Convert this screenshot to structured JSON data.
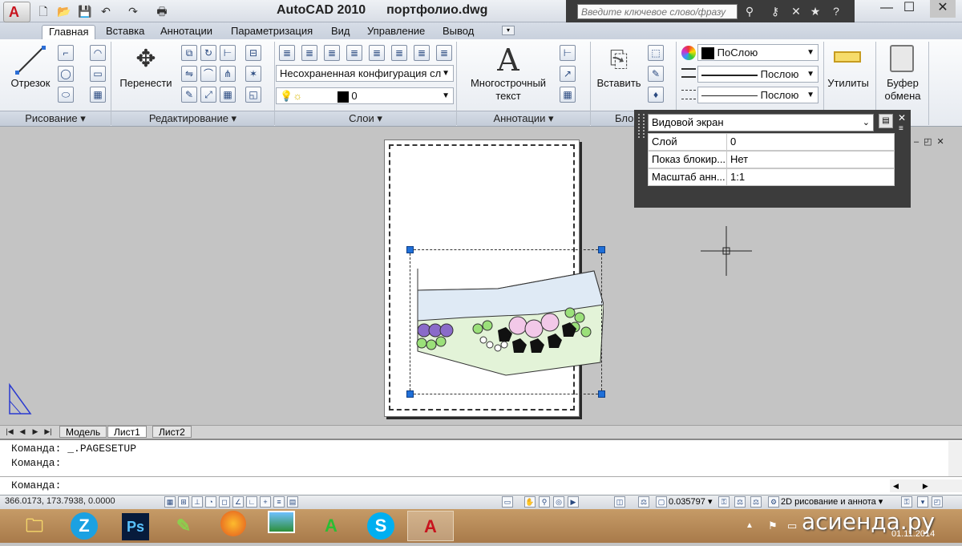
{
  "window": {
    "title_app": "AutoCAD 2010",
    "title_file": "портфолио.dwg",
    "search_placeholder": "Введите ключевое слово/фразу",
    "minimize": "—",
    "maximize": "☐",
    "close": "✕"
  },
  "quick_access": [
    "new-icon",
    "open-icon",
    "save-icon",
    "undo-icon",
    "redo-icon",
    "plot-icon"
  ],
  "tabs": [
    "Главная",
    "Вставка",
    "Аннотации",
    "Параметризация",
    "Вид",
    "Управление",
    "Вывод"
  ],
  "ribbon": {
    "draw": {
      "line_label": "Отрезок",
      "panel": "Рисование"
    },
    "modify": {
      "move_label": "Перенести",
      "panel": "Редактирование"
    },
    "layers": {
      "state_combo": "Несохраненная конфигурация сл",
      "layer_combo": "0",
      "panel": "Слои"
    },
    "annotation": {
      "mtext_label_1": "Многострочный",
      "mtext_label_2": "текст",
      "panel": "Аннотации"
    },
    "block": {
      "insert_label": "Вставить",
      "panel": "Бло"
    },
    "properties": {
      "color_combo": "ПоСлою",
      "linetype_combo": "Послою",
      "lineweight_combo": "Послою"
    },
    "utilities": {
      "label": "Утилиты"
    },
    "clipboard": {
      "label_1": "Буфер",
      "label_2": "обмена"
    }
  },
  "properties_panel": {
    "object_type": "Видовой экран",
    "rows": [
      {
        "key": "Слой",
        "value": "0"
      },
      {
        "key": "Показ блокир...",
        "value": "Нет"
      },
      {
        "key": "Масштаб анн...",
        "value": "1:1"
      }
    ]
  },
  "layout_tabs": {
    "model": "Модель",
    "sheet1": "Лист1",
    "sheet2": "Лист2"
  },
  "command": {
    "line1": "Команда:  _.PAGESETUP",
    "line2": "Команда:",
    "prompt": "Команда:"
  },
  "status": {
    "coords": "366.0173, 173.7938, 0.0000",
    "scale": "0.035797",
    "workspace": "2D рисование и аннота"
  },
  "taskbar": {
    "clock_date": "01.11.2014",
    "watermark": "асиенда.ру"
  }
}
